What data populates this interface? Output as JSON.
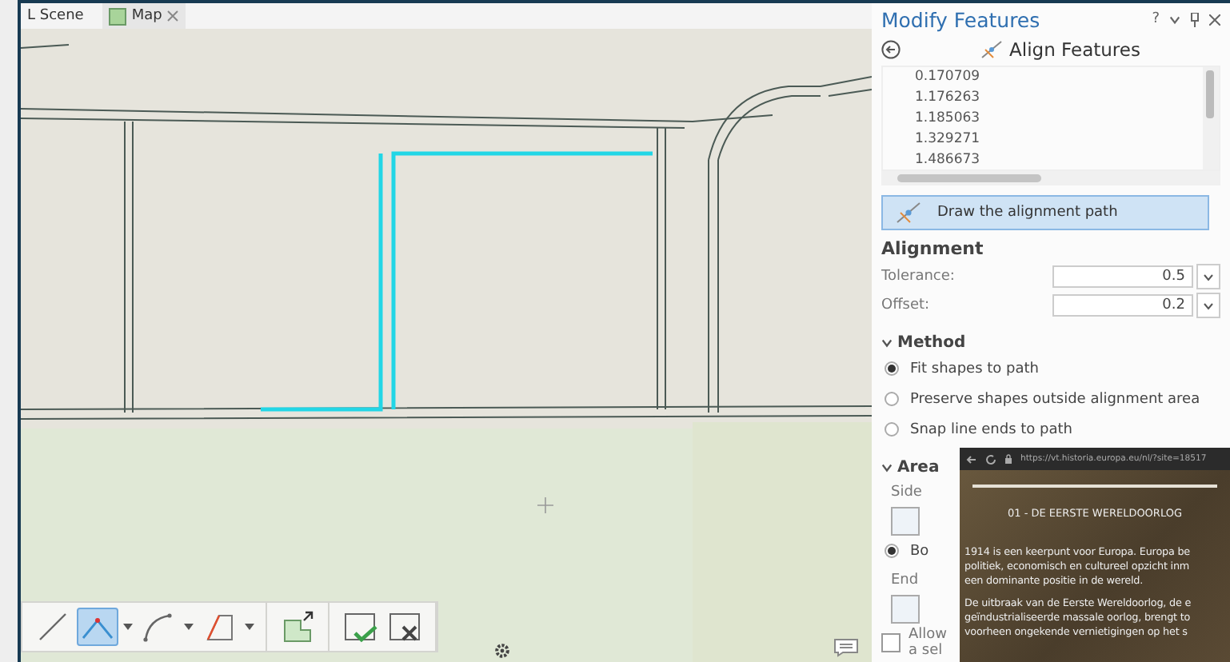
{
  "map_tabs": [
    {
      "label": "L Scene",
      "selected": false
    },
    {
      "label": "Map",
      "selected": true
    }
  ],
  "toolbar": {
    "groups": [
      [
        {
          "kind": "line",
          "selected": false,
          "dropdown": false
        },
        {
          "kind": "polyline",
          "selected": true,
          "dropdown": true
        },
        {
          "kind": "arc",
          "selected": false,
          "dropdown": true
        },
        {
          "kind": "trace",
          "selected": false,
          "dropdown": true
        }
      ],
      [
        {
          "kind": "reshape",
          "selected": false,
          "dropdown": false
        }
      ],
      [
        {
          "kind": "finish",
          "selected": false,
          "dropdown": false
        },
        {
          "kind": "discard",
          "selected": false,
          "dropdown": false
        }
      ]
    ]
  },
  "panel": {
    "title": "Modify Features",
    "help": "?",
    "subtitle": "Align Features",
    "values": [
      "0.170709",
      "1.176263",
      "1.185063",
      "1.329271",
      "1.486673"
    ],
    "draw_button": {
      "label": "Draw the alignment path",
      "selected": true
    },
    "alignment": {
      "heading": "Alignment",
      "fields": [
        {
          "label": "Tolerance:",
          "value": "0.5"
        },
        {
          "label": "Offset:",
          "value": "0.2"
        }
      ]
    },
    "method": {
      "heading": "Method",
      "expanded": true,
      "options": [
        {
          "label": "Fit shapes to path",
          "selected": true
        },
        {
          "label": "Preserve shapes outside alignment area",
          "selected": false
        },
        {
          "label": "Snap line ends to path",
          "selected": false
        }
      ]
    },
    "area": {
      "heading": "Area",
      "expanded": true,
      "side_label": "Side",
      "side_option": {
        "label": "Bo",
        "selected": true
      },
      "end_label": "End",
      "allow": {
        "lines": [
          "Allow",
          "a sel"
        ],
        "checked": false
      }
    }
  },
  "browser": {
    "url": "https://vt.historia.europa.eu/nl/?site=18517",
    "heading": "01 - DE EERSTE WERELDOORLOG",
    "paragraphs": [
      [
        "1914 is een keerpunt voor Europa. Europa be",
        "politiek, economisch en cultureel opzicht inm",
        "een dominante positie in de wereld."
      ],
      [
        "De uitbraak van de Eerste Wereldoorlog, de e",
        "geïndustrialiseerde massale oorlog, brengt to",
        "voorheen ongekende vernietigingen op het s"
      ]
    ]
  }
}
